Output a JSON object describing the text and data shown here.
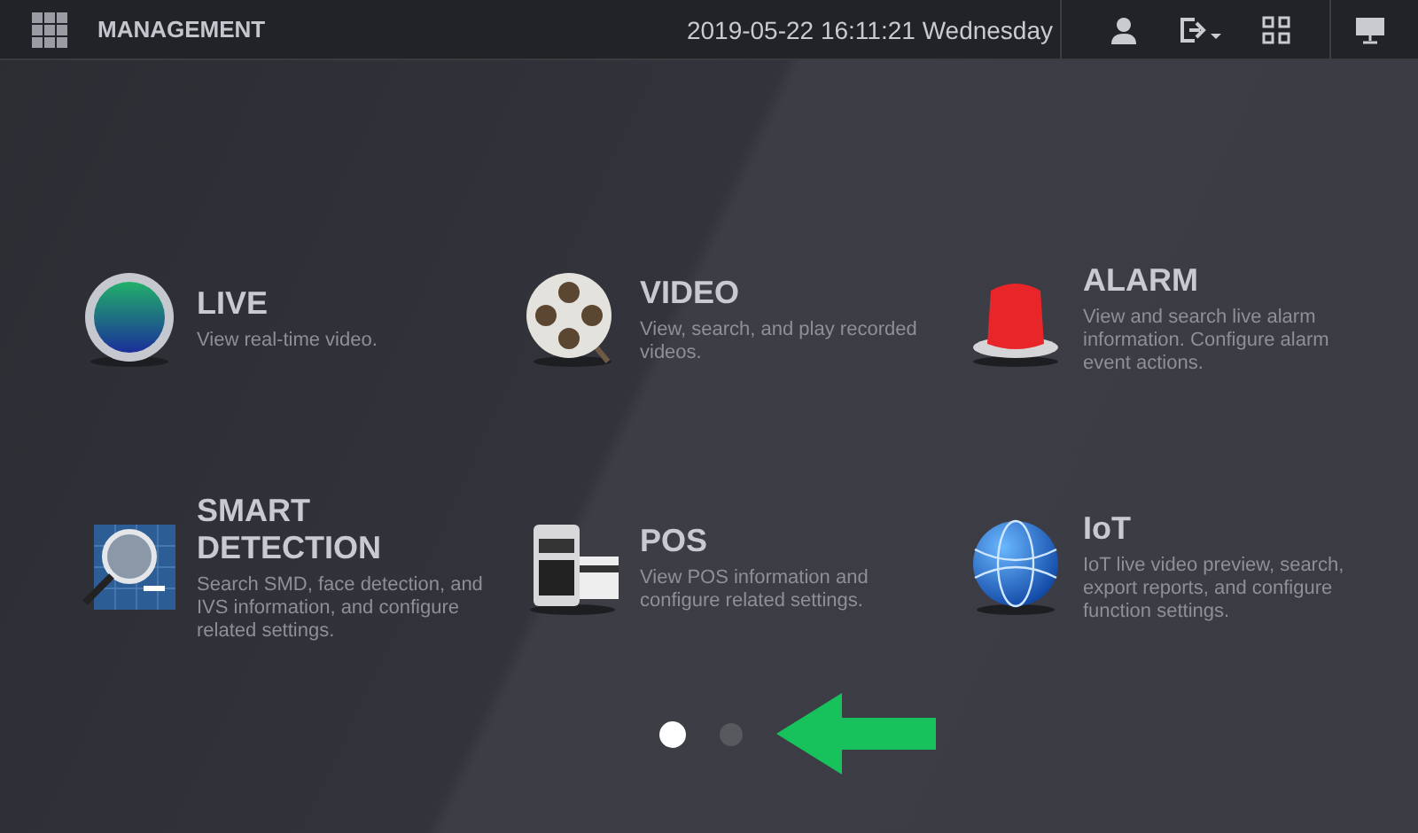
{
  "top_bar": {
    "title": "MANAGEMENT",
    "datetime": "2019-05-22 16:11:21 Wednesday"
  },
  "modules": [
    {
      "kind": "live",
      "title": "LIVE",
      "description": "View real-time video."
    },
    {
      "kind": "video",
      "title": "VIDEO",
      "description": "View, search, and play recorded videos."
    },
    {
      "kind": "alarm",
      "title": "ALARM",
      "description": "View and search live alarm information. Configure alarm event actions."
    },
    {
      "kind": "smart",
      "title": "SMART DETECTION",
      "description": "Search SMD, face detection, and IVS information, and configure related settings."
    },
    {
      "kind": "pos",
      "title": "POS",
      "description": "View POS information and configure related settings."
    },
    {
      "kind": "iot",
      "title": "IoT",
      "description": "IoT live video preview, search, export reports, and configure function settings."
    }
  ],
  "pages": [
    {
      "selected": true
    },
    {
      "selected": false
    }
  ]
}
